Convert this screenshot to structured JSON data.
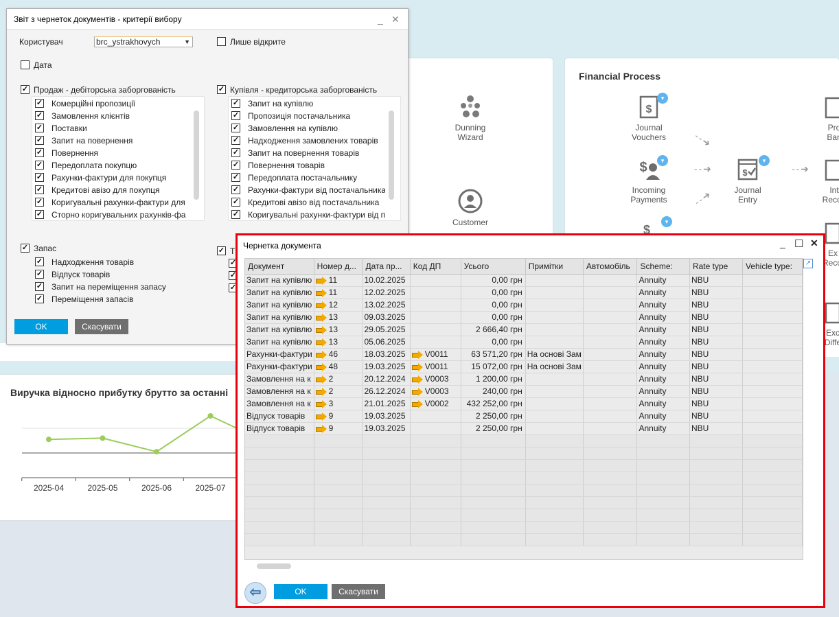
{
  "dashboard": {
    "tiles_mid": [
      {
        "label": "Dunning\nWizard",
        "icon": "dunning-icon"
      },
      {
        "label": "Customer",
        "icon": "customer-icon"
      }
    ],
    "financial_title": "Financial Process",
    "fin_tiles": [
      {
        "label": "Journal\nVouchers",
        "icon": "journal-voucher-icon"
      },
      {
        "label": "Incoming\nPayments",
        "icon": "incoming-payments-icon"
      },
      {
        "label": "Journal\nEntry",
        "icon": "journal-entry-icon"
      },
      {
        "label": "Pro\nBan",
        "icon": "bank-icon"
      },
      {
        "label": "Int\nRecon",
        "icon": "reconciliation-icon"
      },
      {
        "label": "Ex\nRecon",
        "icon": "reconciliation-icon"
      },
      {
        "label": "Exc\nDiffe",
        "icon": "exchange-diff-icon"
      }
    ],
    "chart_title": "Виручка відносно прибутку брутто за останні",
    "chart_data": {
      "type": "line",
      "title": "Виручка відносно прибутку брутто за останні",
      "categories": [
        "2025-04",
        "2025-05",
        "2025-06",
        "2025-07"
      ],
      "series": [
        {
          "values": [
            0.55,
            0.6,
            0.05,
            1.5
          ]
        }
      ],
      "color": "#9ccc5a"
    }
  },
  "criteria": {
    "title": "Звіт з чернеток документів - критерії вибору",
    "user_label": "Користувач",
    "user_value": "brc_ystrakhovych",
    "only_open_label": "Лише відкрите",
    "date_label": "Дата",
    "sales_group": "Продаж - дебіторська заборгованість",
    "sales_items": [
      "Комерційні пропозиції",
      "Замовлення клієнтів",
      "Поставки",
      "Запит на повернення",
      "Повернення",
      "Передоплата покупцю",
      "Рахунки-фактури для покупця",
      "Кредитові авізо для покупця",
      "Коригувальні рахунки-фактури для",
      "Сторно коригувальних рахунків-фа"
    ],
    "purchase_group": "Купівля - кредиторська заборгованість",
    "purchase_items": [
      "Запит на купівлю",
      "Пропозиція постачальника",
      "Замовлення на купівлю",
      "Надходження замовлених товарів",
      "Запит на повернення товарів",
      "Повернення товарів",
      "Передоплата постачальнику",
      "Рахунки-фактури від постачальника",
      "Кредитові авізо від постачальника",
      "Коригувальні рахунки-фактури від п"
    ],
    "inventory_group": "Запас",
    "inventory_items": [
      "Надходження товарів",
      "Відпуск товарів",
      "Запит на переміщення запасу",
      "Переміщення запасів"
    ],
    "other_group": "Т",
    "ok": "OK",
    "cancel": "Скасувати"
  },
  "draft": {
    "title": "Чернетка документа",
    "columns": [
      "Документ",
      "Номер д...",
      "Дата пр...",
      "Код ДП",
      "Усього",
      "Примітки",
      "Автомобіль",
      "Scheme:",
      "Rate type",
      "Vehicle type:"
    ],
    "rows": [
      {
        "doc": "Запит на купівлю",
        "num": "11",
        "date": "10.02.2025",
        "bp": "",
        "total": "0,00 грн",
        "notes": "",
        "car": "",
        "scheme": "Annuity",
        "rate": "NBU"
      },
      {
        "doc": "Запит на купівлю",
        "num": "11",
        "date": "12.02.2025",
        "bp": "",
        "total": "0,00 грн",
        "notes": "",
        "car": "",
        "scheme": "Annuity",
        "rate": "NBU"
      },
      {
        "doc": "Запит на купівлю",
        "num": "12",
        "date": "13.02.2025",
        "bp": "",
        "total": "0,00 грн",
        "notes": "",
        "car": "",
        "scheme": "Annuity",
        "rate": "NBU"
      },
      {
        "doc": "Запит на купівлю",
        "num": "13",
        "date": "09.03.2025",
        "bp": "",
        "total": "0,00 грн",
        "notes": "",
        "car": "",
        "scheme": "Annuity",
        "rate": "NBU"
      },
      {
        "doc": "Запит на купівлю",
        "num": "13",
        "date": "29.05.2025",
        "bp": "",
        "total": "2 666,40 грн",
        "notes": "",
        "car": "",
        "scheme": "Annuity",
        "rate": "NBU"
      },
      {
        "doc": "Запит на купівлю",
        "num": "13",
        "date": "05.06.2025",
        "bp": "",
        "total": "0,00 грн",
        "notes": "",
        "car": "",
        "scheme": "Annuity",
        "rate": "NBU"
      },
      {
        "doc": "Рахунки-фактури",
        "num": "46",
        "date": "18.03.2025",
        "bp": "V0011",
        "total": "63 571,20 грн",
        "notes": "На основі Зам",
        "car": "",
        "scheme": "Annuity",
        "rate": "NBU"
      },
      {
        "doc": "Рахунки-фактури",
        "num": "48",
        "date": "19.03.2025",
        "bp": "V0011",
        "total": "15 072,00 грн",
        "notes": "На основі Зам",
        "car": "",
        "scheme": "Annuity",
        "rate": "NBU"
      },
      {
        "doc": "Замовлення на к",
        "num": "2",
        "date": "20.12.2024",
        "bp": "V0003",
        "total": "1 200,00 грн",
        "notes": "",
        "car": "",
        "scheme": "Annuity",
        "rate": "NBU"
      },
      {
        "doc": "Замовлення на к",
        "num": "2",
        "date": "26.12.2024",
        "bp": "V0003",
        "total": "240,00 грн",
        "notes": "",
        "car": "",
        "scheme": "Annuity",
        "rate": "NBU"
      },
      {
        "doc": "Замовлення на к",
        "num": "3",
        "date": "21.01.2025",
        "bp": "V0002",
        "total": "432 252,00 грн",
        "notes": "",
        "car": "",
        "scheme": "Annuity",
        "rate": "NBU"
      },
      {
        "doc": "Відпуск товарів",
        "num": "9",
        "date": "19.03.2025",
        "bp": "",
        "total": "2 250,00 грн",
        "notes": "",
        "car": "",
        "scheme": "Annuity",
        "rate": "NBU"
      },
      {
        "doc": "Відпуск товарів",
        "num": "9",
        "date": "19.03.2025",
        "bp": "",
        "total": "2 250,00 грн",
        "notes": "",
        "car": "",
        "scheme": "Annuity",
        "rate": "NBU"
      }
    ],
    "empty_rows": 9,
    "ok": "OK",
    "cancel": "Скасувати"
  }
}
